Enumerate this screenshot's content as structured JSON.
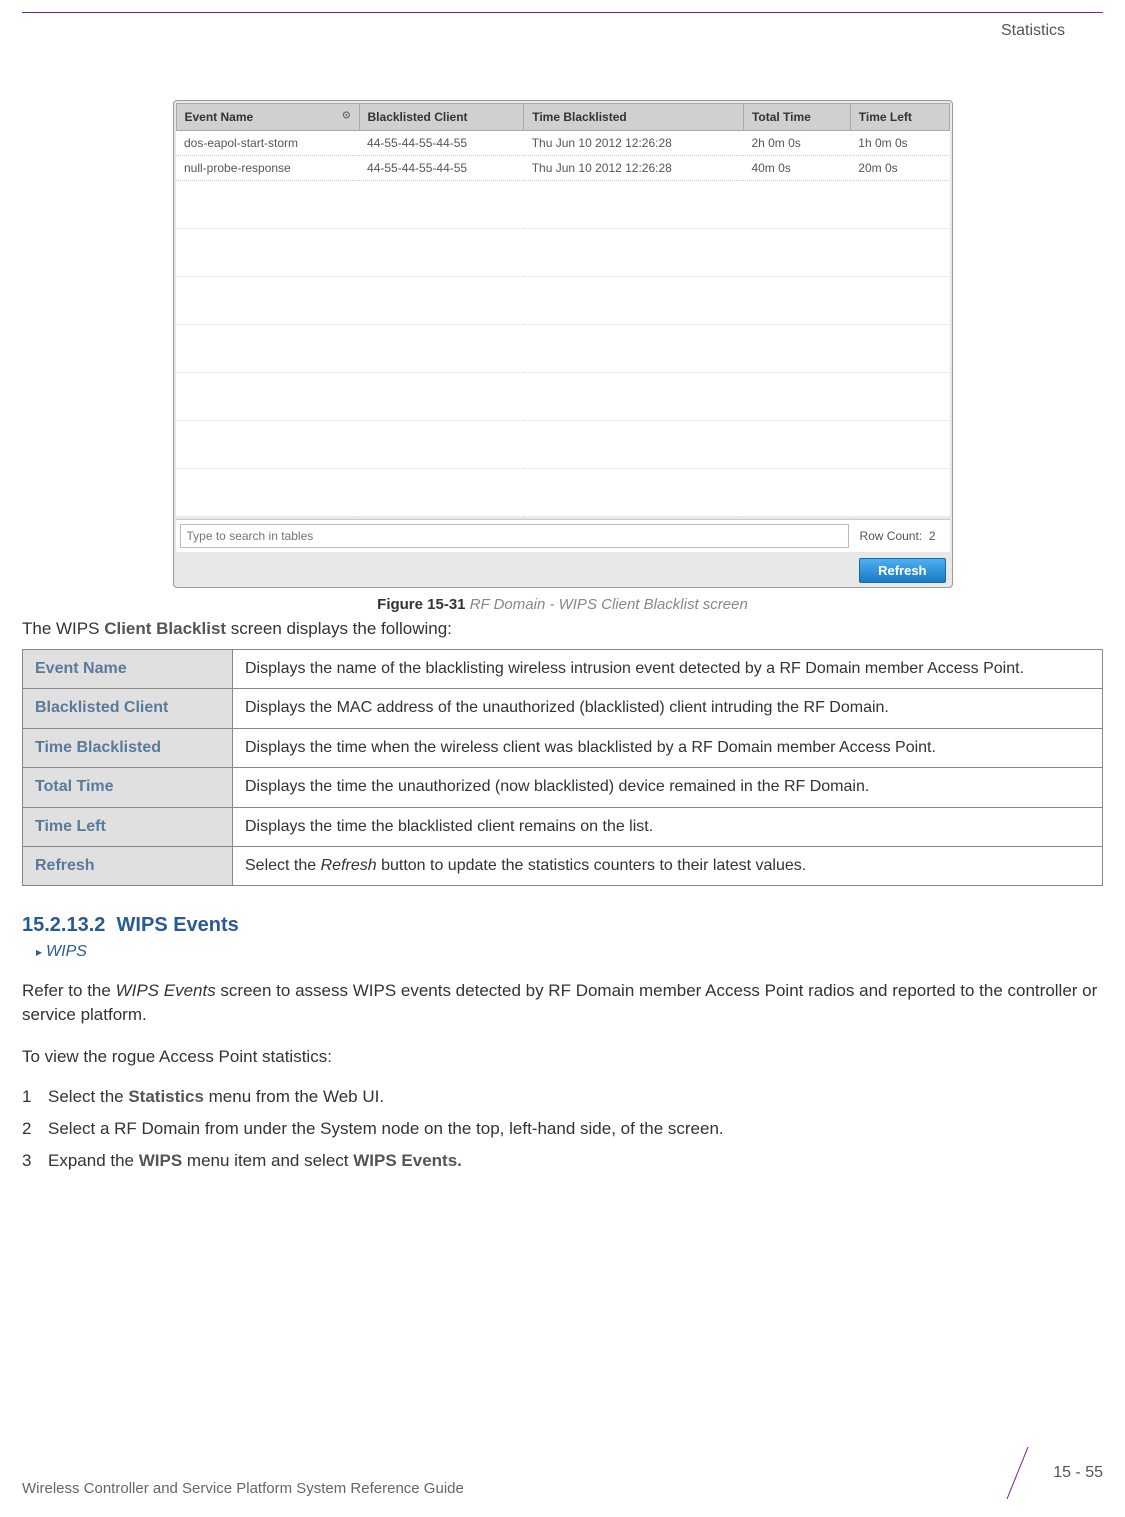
{
  "header": {
    "section_label": "Statistics"
  },
  "screenshot": {
    "columns": [
      "Event Name",
      "Blacklisted Client",
      "Time Blacklisted",
      "Total Time",
      "Time Left"
    ],
    "rows": [
      {
        "event": "dos-eapol-start-storm",
        "client": "44-55-44-55-44-55",
        "time_bl": "Thu Jun 10 2012 12:26:28",
        "total": "2h 0m 0s",
        "left": "1h 0m 0s"
      },
      {
        "event": "null-probe-response",
        "client": "44-55-44-55-44-55",
        "time_bl": "Thu Jun 10 2012 12:26:28",
        "total": "40m 0s",
        "left": "20m 0s"
      }
    ],
    "search_placeholder": "Type to search in tables",
    "row_count_label": "Row Count:",
    "row_count_value": "2",
    "refresh_label": "Refresh"
  },
  "figure": {
    "number": "Figure 15-31",
    "title": "RF Domain - WIPS Client Blacklist screen"
  },
  "intro": {
    "pre": "The WIPS ",
    "bold": "Client Blacklist",
    "post": " screen displays the following:"
  },
  "desc_rows": [
    {
      "label": "Event Name",
      "desc": "Displays the name of the blacklisting wireless intrusion event detected by a RF Domain member Access Point."
    },
    {
      "label": "Blacklisted Client",
      "desc": "Displays the MAC address of the unauthorized (blacklisted) client intruding the RF Domain."
    },
    {
      "label": "Time Blacklisted",
      "desc": "Displays the time when the wireless client was blacklisted by a RF Domain member Access Point."
    },
    {
      "label": "Total Time",
      "desc": "Displays the time the unauthorized (now blacklisted) device remained in the RF Domain."
    },
    {
      "label": "Time Left",
      "desc": "Displays the time the blacklisted client remains on the list."
    },
    {
      "label": "Refresh",
      "desc_pre": "Select the ",
      "desc_italic": "Refresh",
      "desc_post": " button to update the statistics counters to their latest values."
    }
  ],
  "section": {
    "number": "15.2.13.2",
    "title": "WIPS Events",
    "breadcrumb": "WIPS"
  },
  "para1": {
    "pre": "Refer to the ",
    "italic": "WIPS Events",
    "post": " screen to assess WIPS events detected by RF Domain member Access Point radios and reported to the controller or service platform."
  },
  "para2": "To view the rogue Access Point statistics:",
  "steps": [
    {
      "num": "1",
      "pre": "Select the ",
      "bold": "Statistics",
      "post": " menu from the Web UI."
    },
    {
      "num": "2",
      "text": "Select a RF Domain from under the System node on the top, left-hand side, of the screen."
    },
    {
      "num": "3",
      "pre": "Expand the ",
      "bold": "WIPS",
      "mid": " menu item and select ",
      "bold2": "WIPS Events."
    }
  ],
  "footer": {
    "text": "Wireless Controller and Service Platform System Reference Guide",
    "page": "15 - 55"
  }
}
